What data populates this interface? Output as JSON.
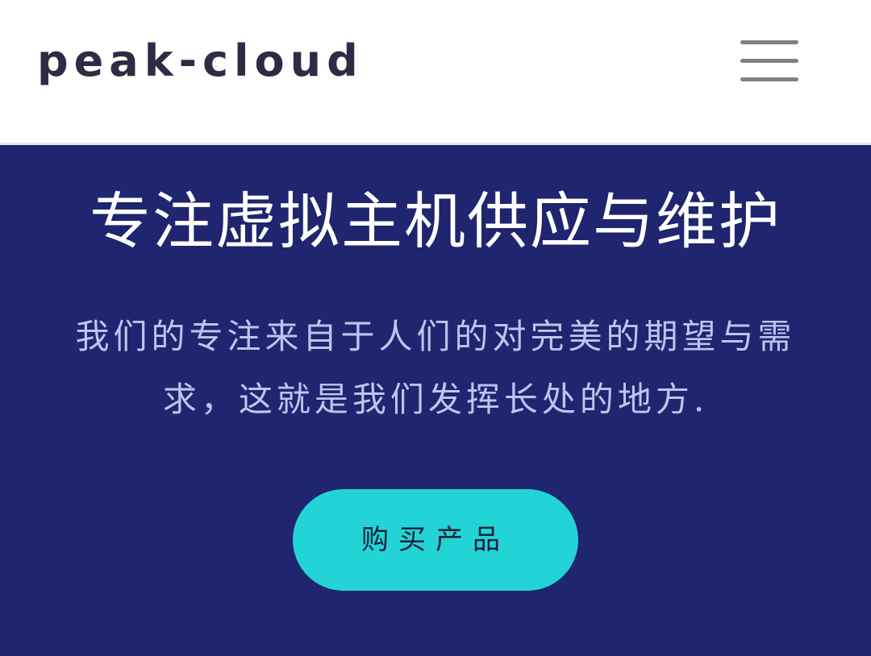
{
  "header": {
    "brand": "peak-cloud",
    "menu_icon": "hamburger-menu-icon"
  },
  "hero": {
    "title": "专注虚拟主机供应与维护",
    "description": "我们的专注来自于人们的对完美的期望与需求，这就是我们发挥长处的地方.",
    "cta_label": "购买产品"
  },
  "colors": {
    "header_background": "#ffffff",
    "hero_background": "#1f256e",
    "title_text": "#ffffff",
    "description_text": "#bfc3ee",
    "cta_background": "#22d4d6",
    "cta_text": "#1b1e3a",
    "brand_text": "#2e2c44",
    "menu_icon": "#808080"
  }
}
